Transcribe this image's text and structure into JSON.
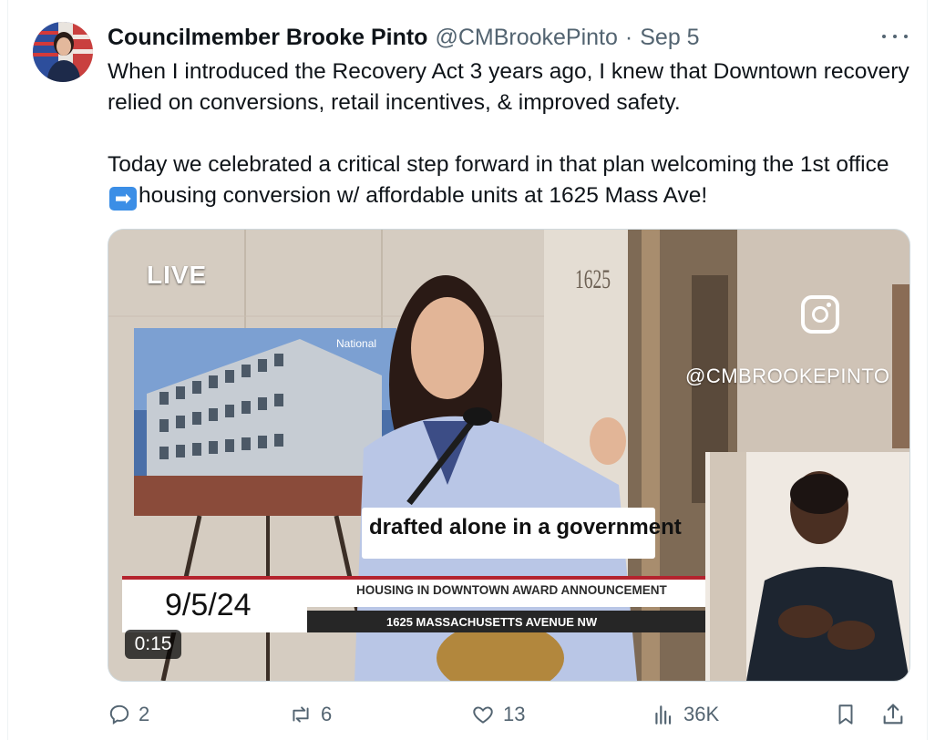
{
  "tweet": {
    "author_name": "Councilmember Brooke Pinto",
    "handle": "@CMBrookePinto",
    "separator": "·",
    "date": "Sep 5",
    "paragraph1": "When I introduced the Recovery Act 3 years ago, I knew that Downtown recovery relied on conversions, retail incentives, & improved safety.",
    "paragraph2_before": "Today we celebrated a critical step forward in that plan welcoming the 1st office",
    "paragraph2_after": "housing conversion w/ affordable units at 1625 Mass Ave!",
    "arrow_emoji": "➡"
  },
  "video": {
    "live_label": "LIVE",
    "sign_brand": "National",
    "building_number": "1625",
    "instagram_handle": "@CMBROOKEPINTO",
    "caption": "drafted alone in a government",
    "lower_third_date": "9/5/24",
    "lower_third_title": "HOUSING IN DOWNTOWN AWARD ANNOUNCEMENT",
    "lower_third_address": "1625 MASSACHUSETTS AVENUE NW",
    "duration": "0:15"
  },
  "actions": {
    "replies": "2",
    "reposts": "6",
    "likes": "13",
    "views": "36K"
  },
  "icons": [
    "reply-icon",
    "repost-icon",
    "like-icon",
    "views-icon",
    "bookmark-icon",
    "share-icon",
    "more-icon",
    "instagram-icon"
  ]
}
